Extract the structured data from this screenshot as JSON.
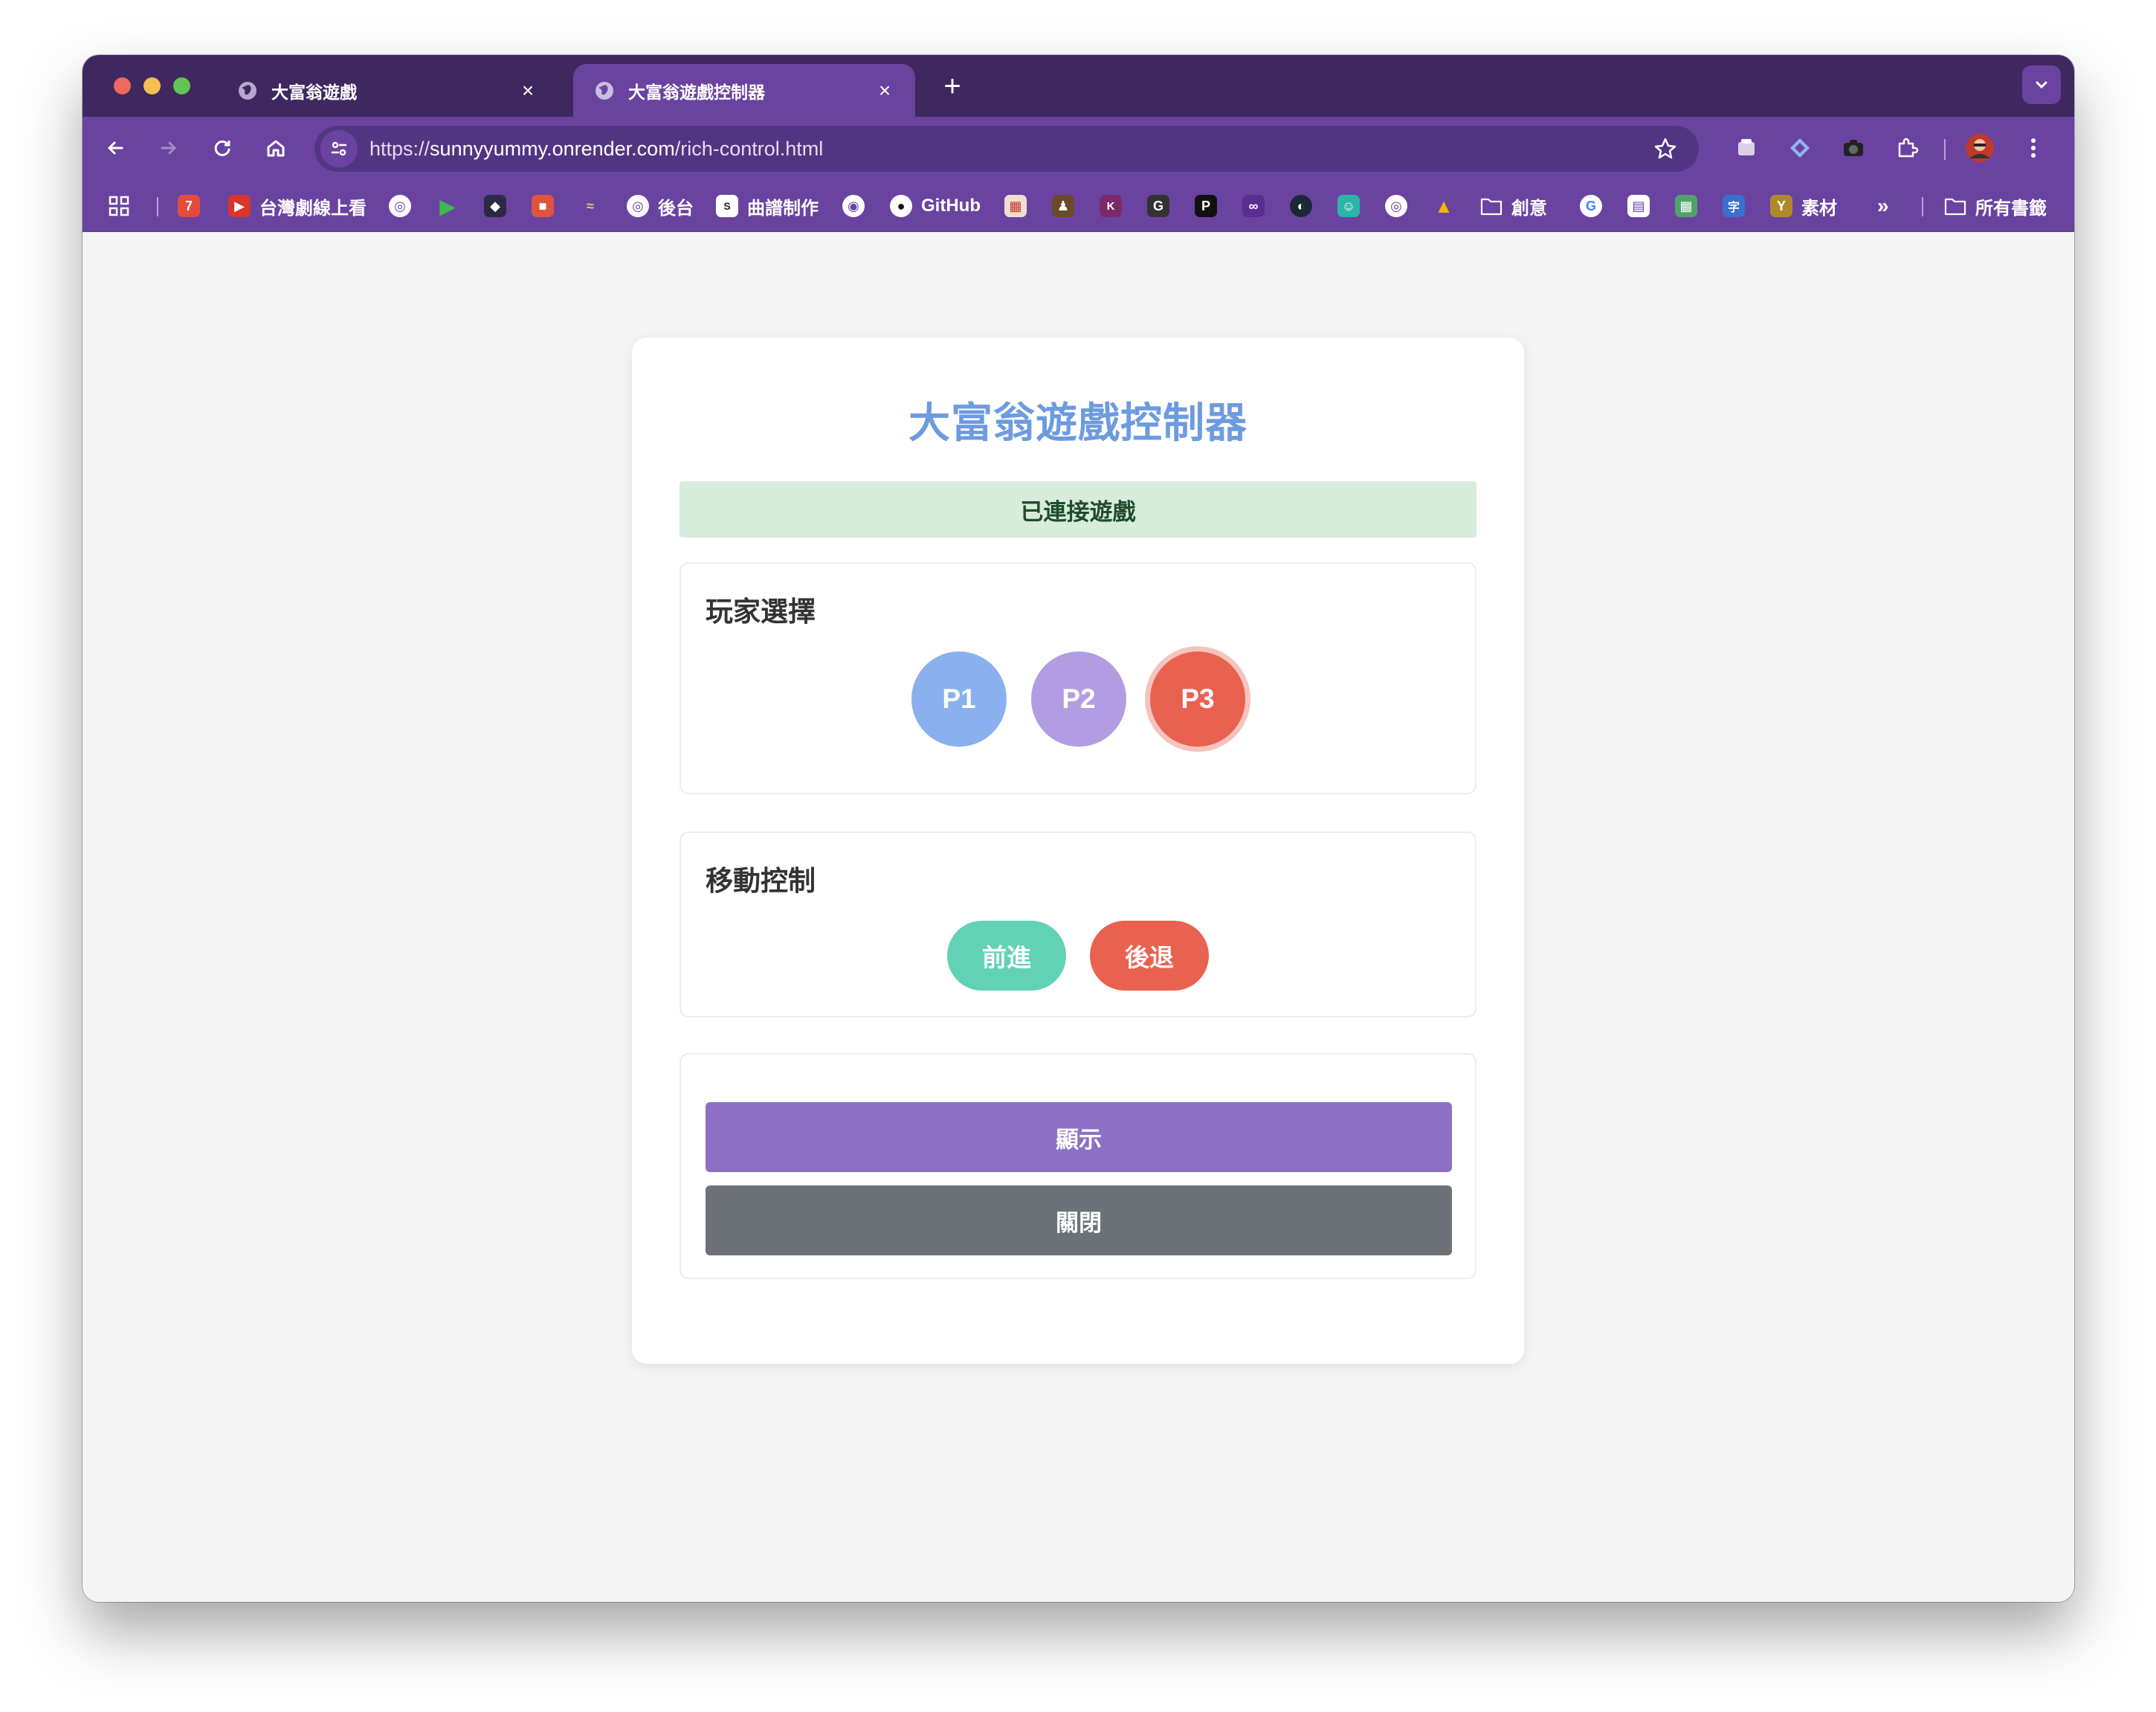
{
  "browser": {
    "tabs": [
      {
        "title": "大富翁遊戲",
        "active": false
      },
      {
        "title": "大富翁遊戲控制器",
        "active": true
      }
    ],
    "new_tab_label": "+",
    "close_label": "×",
    "url_prefix": "https://",
    "url_host": "sunnyyummy.onrender.com",
    "url_path": "/rich-control.html",
    "colors": {
      "tabstrip": "#3f275f",
      "toolbar": "#6a43a0"
    }
  },
  "bookmarks": [
    {
      "label": "",
      "icon": "seven-icon",
      "glyph": "7",
      "color": "#e64a3c"
    },
    {
      "label": "台灣劇線上看",
      "icon": "play-tv-icon",
      "glyph": "▶",
      "color": "#d9352b"
    },
    {
      "label": "",
      "icon": "globe-icon",
      "glyph": "◎",
      "color": "#8a6cbf"
    },
    {
      "label": "",
      "icon": "green-play-icon",
      "glyph": "▶",
      "color": "#3fb950"
    },
    {
      "label": "",
      "icon": "shield-icon",
      "glyph": "◆",
      "color": "#2a2a44"
    },
    {
      "label": "",
      "icon": "bag-icon",
      "glyph": "■",
      "color": "#e0543f"
    },
    {
      "label": "",
      "icon": "sparkle-icon",
      "glyph": "≈",
      "color": "#9bbf3a"
    },
    {
      "label": "後台",
      "icon": "globe-icon",
      "glyph": "◎",
      "color": "#8a6cbf"
    },
    {
      "label": "曲譜制作",
      "icon": "spu-icon",
      "glyph": "S",
      "color": "#222"
    },
    {
      "label": "",
      "icon": "target-icon",
      "glyph": "◉",
      "color": "#ddd"
    },
    {
      "label": "GitHub",
      "icon": "github-icon",
      "glyph": "●",
      "color": "#111"
    },
    {
      "label": "",
      "icon": "grid-icon",
      "glyph": "▦",
      "color": "#e6c7b8"
    },
    {
      "label": "",
      "icon": "avatar-art-icon",
      "glyph": "♟",
      "color": "#6b4a2b"
    },
    {
      "label": "",
      "icon": "kl-icon",
      "glyph": "K",
      "color": "#7a2a6a"
    },
    {
      "label": "",
      "icon": "g-icon",
      "glyph": "G",
      "color": "#333"
    },
    {
      "label": "",
      "icon": "patreon-icon",
      "glyph": "P",
      "color": "#111"
    },
    {
      "label": "",
      "icon": "mask-icon",
      "glyph": "∞",
      "color": "#5a2d91"
    },
    {
      "label": "",
      "icon": "steam-icon",
      "glyph": "◐",
      "color": "#1b2838"
    },
    {
      "label": "",
      "icon": "bot-icon",
      "glyph": "☺",
      "color": "#2bb5a8"
    },
    {
      "label": "",
      "icon": "globe-icon",
      "glyph": "◎",
      "color": "#8a6cbf"
    },
    {
      "label": "",
      "icon": "drive-icon",
      "glyph": "▲",
      "color": "#f4b400"
    },
    {
      "label": "創意",
      "icon": "folder-icon",
      "glyph": "▭",
      "color": "transparent"
    },
    {
      "label": "",
      "icon": "google-icon",
      "glyph": "G",
      "color": "#ffffff"
    },
    {
      "label": "",
      "icon": "printer-icon",
      "glyph": "▤",
      "color": "#9b8fb5"
    },
    {
      "label": "",
      "icon": "map-icon",
      "glyph": "▦",
      "color": "#4fa36a"
    },
    {
      "label": "",
      "icon": "dictionary-icon",
      "glyph": "字",
      "color": "#3a6fd0"
    },
    {
      "label": "素材",
      "icon": "brand-icon",
      "glyph": "Y",
      "color": "#b08a2a"
    }
  ],
  "bookmarks_overflow": "»",
  "all_bookmarks": "所有書籤",
  "page": {
    "title": "大富翁遊戲控制器",
    "status": "已連接遊戲",
    "player_section": {
      "title": "玩家選擇",
      "players": [
        {
          "label": "P1",
          "color": "#8ab1ed",
          "selected": false
        },
        {
          "label": "P2",
          "color": "#b39de2",
          "selected": false
        },
        {
          "label": "P3",
          "color": "#e9614f",
          "selected": true
        }
      ]
    },
    "movement_section": {
      "title": "移動控制",
      "forward": "前進",
      "back": "後退"
    },
    "actions": {
      "show": "顯示",
      "close": "關閉"
    }
  }
}
